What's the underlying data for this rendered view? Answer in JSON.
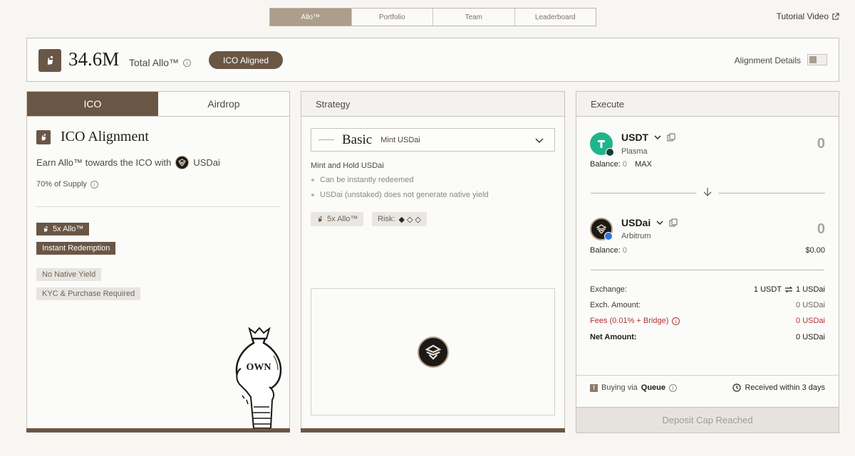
{
  "nav": {
    "tabs": [
      "Allo™",
      "Portfolio",
      "Team",
      "Leaderboard"
    ],
    "active_index": 0,
    "tutorial": "Tutorial Video"
  },
  "header": {
    "total_value": "34.6M",
    "total_label": "Total Allo™",
    "badge": "ICO Aligned",
    "alignment_details": "Alignment Details"
  },
  "left_panel": {
    "tabs": [
      "ICO",
      "Airdrop"
    ],
    "title": "ICO Alignment",
    "earn_text": "Earn Allo™ towards the ICO with",
    "earn_token": "USDai",
    "supply": "70% of Supply",
    "tags_dark": [
      "5x Allo™",
      "Instant Redemption"
    ],
    "tags_light": [
      "No Native Yield",
      "KYC & Purchase Required"
    ],
    "bag_text": "OWN"
  },
  "strategy": {
    "header": "Strategy",
    "select_name": "Basic",
    "select_sub": "Mint USDai",
    "subtitle": "Mint and Hold USDai",
    "bullets": [
      "Can be instantly redeemed",
      "USDai (unstaked) does not generate native yield"
    ],
    "multiplier_tag": "5x Allo™",
    "risk_label": "Risk:",
    "risk_symbols": "◆ ◇ ◇"
  },
  "execute": {
    "header": "Execute",
    "from": {
      "symbol": "USDT",
      "network": "Plasma",
      "amount": "0",
      "balance_label": "Balance:",
      "balance": "0",
      "max": "MAX"
    },
    "to": {
      "symbol": "USDai",
      "network": "Arbitrum",
      "amount": "0",
      "balance_label": "Balance:",
      "balance": "0",
      "usd_value": "$0.00"
    },
    "exchange_label": "Exchange:",
    "exchange_from": "1 USDT",
    "exchange_to": "1 USDai",
    "exch_amount_label": "Exch. Amount:",
    "exch_amount": "0 USDai",
    "fees_label": "Fees (0.01% + Bridge)",
    "fees": "0 USDai",
    "net_label": "Net Amount:",
    "net": "0 USDai",
    "queue_prefix": "Buying via",
    "queue_word": "Queue",
    "received": "Received within 3 days",
    "button": "Deposit Cap Reached"
  },
  "colors": {
    "brand_brown": "#6a5645",
    "nav_active": "#ad9d8b",
    "usdt_green": "#1fb58c",
    "fee_red": "#b03232"
  }
}
